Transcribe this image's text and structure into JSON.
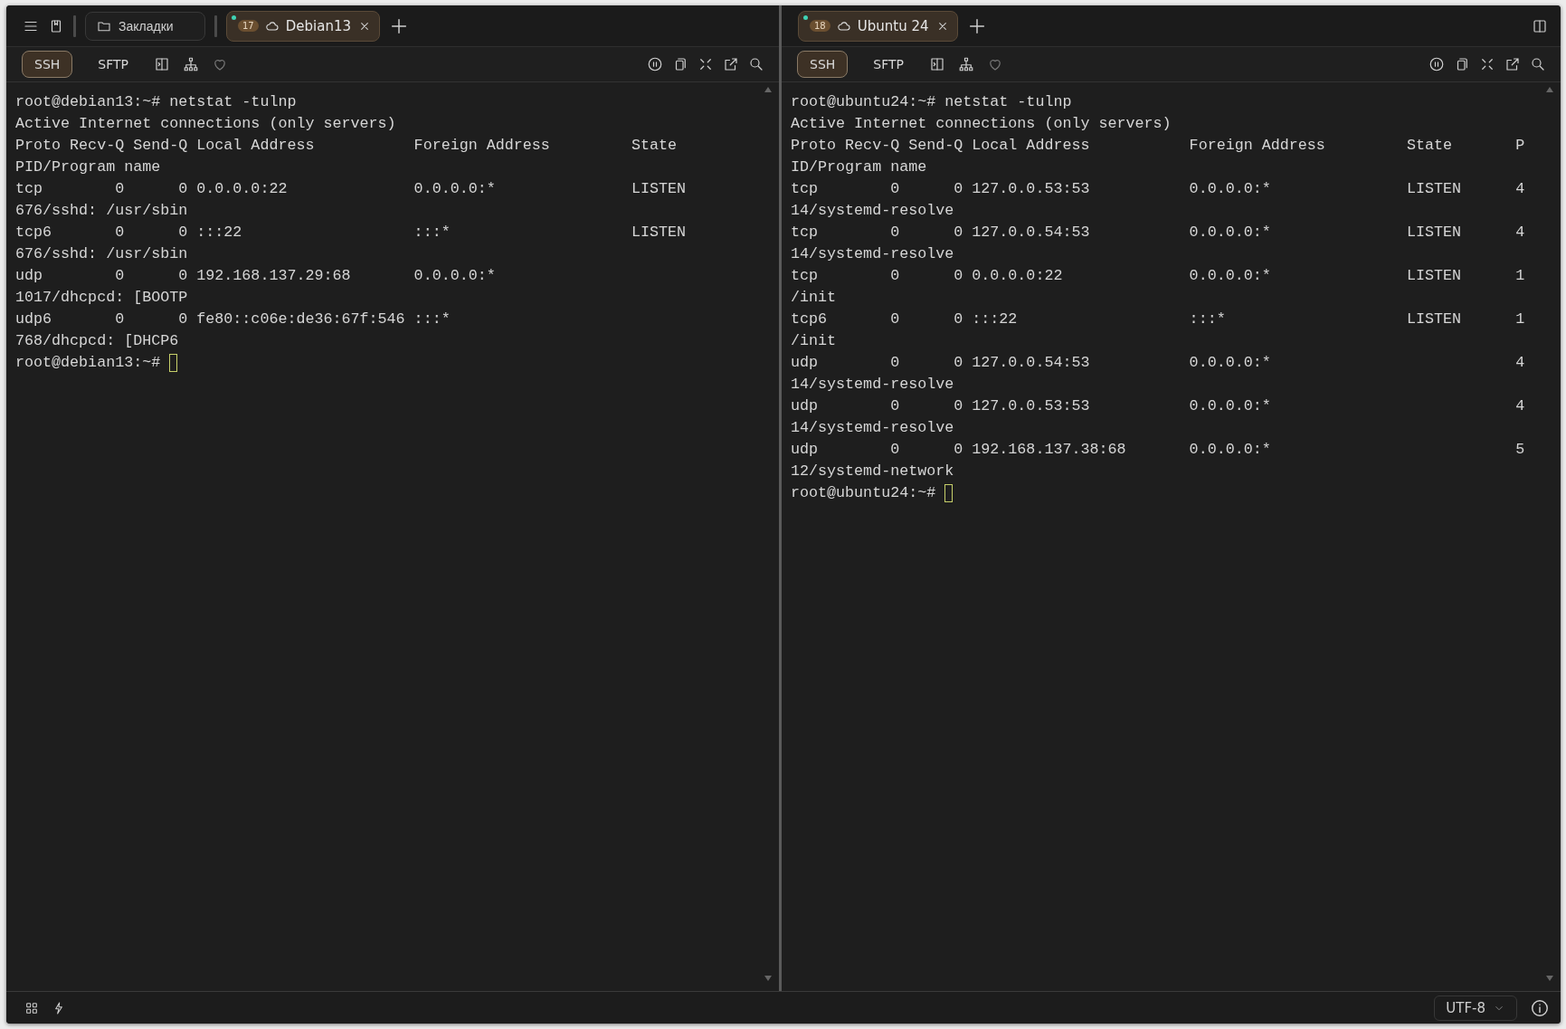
{
  "panes": [
    {
      "kind": "left",
      "tabs": [
        {
          "badge": "17",
          "title": "Debian13",
          "selected": true,
          "connected": true
        }
      ],
      "modes": [
        {
          "label": "SSH",
          "selected": true
        },
        {
          "label": "SFTP",
          "selected": false
        }
      ],
      "terminal": {
        "lines": [
          "root@debian13:~# netstat -tulnp",
          "Active Internet connections (only servers)",
          "Proto Recv-Q Send-Q Local Address           Foreign Address         State",
          "PID/Program name",
          "tcp        0      0 0.0.0.0:22              0.0.0.0:*               LISTEN",
          "676/sshd: /usr/sbin",
          "tcp6       0      0 :::22                   :::*                    LISTEN",
          "676/sshd: /usr/sbin",
          "udp        0      0 192.168.137.29:68       0.0.0.0:*",
          "1017/dhcpcd: [BOOTP",
          "udp6       0      0 fe80::c06e:de36:67f:546 :::*",
          "768/dhcpcd: [DHCP6"
        ],
        "prompt": "root@debian13:~#"
      }
    },
    {
      "kind": "right",
      "tabs": [
        {
          "badge": "18",
          "title": "Ubuntu 24",
          "selected": true,
          "connected": true
        }
      ],
      "modes": [
        {
          "label": "SSH",
          "selected": true
        },
        {
          "label": "SFTP",
          "selected": false
        }
      ],
      "terminal": {
        "lines": [
          "root@ubuntu24:~# netstat -tulnp",
          "Active Internet connections (only servers)",
          "Proto Recv-Q Send-Q Local Address           Foreign Address         State       P",
          "ID/Program name",
          "tcp        0      0 127.0.0.53:53           0.0.0.0:*               LISTEN      4",
          "14/systemd-resolve",
          "tcp        0      0 127.0.0.54:53           0.0.0.0:*               LISTEN      4",
          "14/systemd-resolve",
          "tcp        0      0 0.0.0.0:22              0.0.0.0:*               LISTEN      1",
          "/init",
          "tcp6       0      0 :::22                   :::*                    LISTEN      1",
          "/init",
          "udp        0      0 127.0.0.54:53           0.0.0.0:*                           4",
          "14/systemd-resolve",
          "udp        0      0 127.0.0.53:53           0.0.0.0:*                           4",
          "14/systemd-resolve",
          "udp        0      0 192.168.137.38:68       0.0.0.0:*                           5",
          "12/systemd-network"
        ],
        "prompt": "root@ubuntu24:~#"
      }
    }
  ],
  "bookmarks": {
    "label": "Закладки"
  },
  "status_bar": {
    "encoding": "UTF-8"
  }
}
